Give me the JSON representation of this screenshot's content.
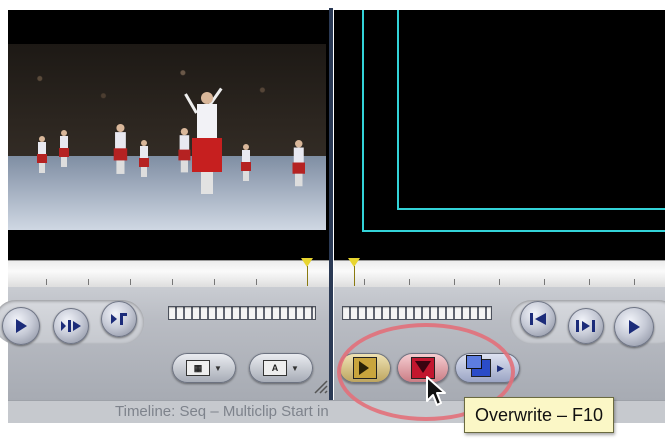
{
  "viewer_left": {
    "controls": {
      "play_icon": "play-icon",
      "play_around_icon": "play-around-current-icon",
      "mark_clip_icon": "mark-clip-icon",
      "view_popup_icon": "view-popup-icon",
      "overlay_popup_icon": "overlay-popup-icon",
      "overlay_popup_glyph": "A"
    }
  },
  "viewer_right": {
    "overlay_color": "#33d3d8",
    "controls": {
      "previous_edit_icon": "previous-edit-icon",
      "play_in_to_out_icon": "play-in-to-out-icon",
      "play_icon": "play-icon"
    }
  },
  "edit_buttons": {
    "insert_icon": "insert-edit-icon",
    "overwrite_icon": "overwrite-edit-icon",
    "replace_icon": "replace-edit-icon",
    "insert_color": "#c9a53d",
    "overwrite_color": "#c2162e",
    "replace_color": "#2b4cc8"
  },
  "status_bar": {
    "text": "Timeline:  Seq – Multiclip Start in"
  },
  "tooltip": {
    "text": "Overwrite – F10"
  },
  "highlight_color": "#e2707a"
}
